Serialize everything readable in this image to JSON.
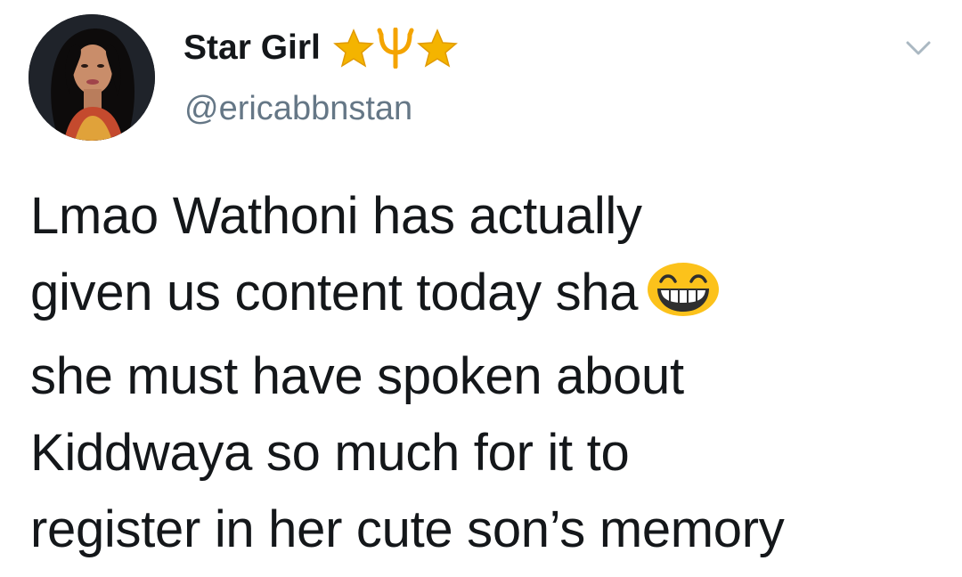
{
  "tweet": {
    "display_name": "Star Girl",
    "name_emojis": [
      "star-emoji",
      "trident-emoji",
      "star-emoji"
    ],
    "handle": "@ericabbnstan",
    "text_lines": [
      "Lmao Wathoni has actually",
      "given us content today sha",
      "she must have spoken about",
      "Kiddwaya so much for it to",
      "register in her cute son’s memory"
    ],
    "inline_emoji": "grinning-squinting-face-emoji"
  },
  "colors": {
    "text": "#14171a",
    "handle": "#657786",
    "caret": "#aab8c2",
    "star": "#f4b400",
    "emoji_face": "#fcc21b"
  }
}
